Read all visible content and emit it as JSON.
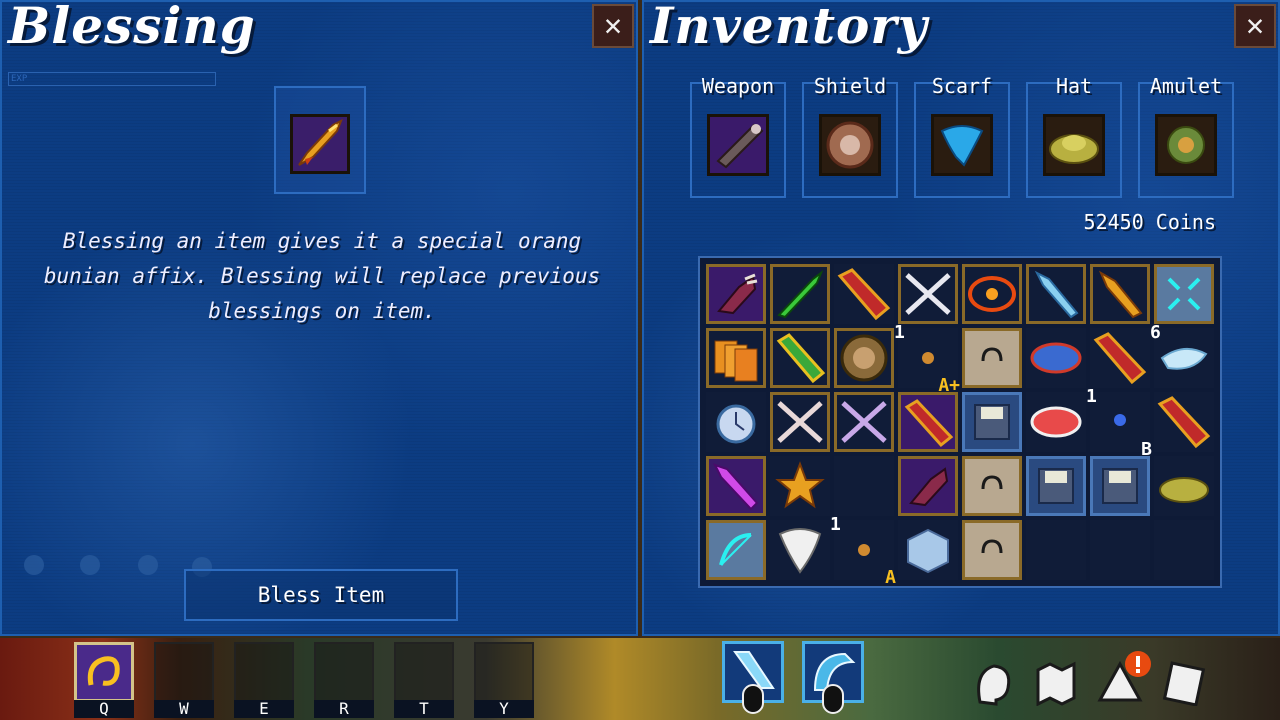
{
  "blessing": {
    "title": "Blessing",
    "close": "✕",
    "exp_label": "EXP",
    "description": "Blessing an item gives it a special orang bunian affix. Blessing will replace previous blessings on item.",
    "button": "Bless Item"
  },
  "inventory": {
    "title": "Inventory",
    "close": "✕",
    "equipment": [
      {
        "label": "Weapon"
      },
      {
        "label": "Shield"
      },
      {
        "label": "Scarf"
      },
      {
        "label": "Hat"
      },
      {
        "label": "Amulet"
      }
    ],
    "coins": "52450 Coins",
    "badges": {
      "r2c4_count": "1",
      "r2c4_grade": "A+",
      "r2c8_count": "6",
      "r3c7_count": "1",
      "r3c7_grade": "B",
      "r5c3_count": "1",
      "r5c3_grade": "A"
    }
  },
  "hotbar": {
    "keys": [
      "Q",
      "W",
      "E",
      "R",
      "T",
      "Y"
    ]
  },
  "colors": {
    "panel_bg": "#0c3c82",
    "panel_border": "#1e5fb0",
    "item_frame": "#8a6a28",
    "close_bg": "#3b1e1a"
  }
}
